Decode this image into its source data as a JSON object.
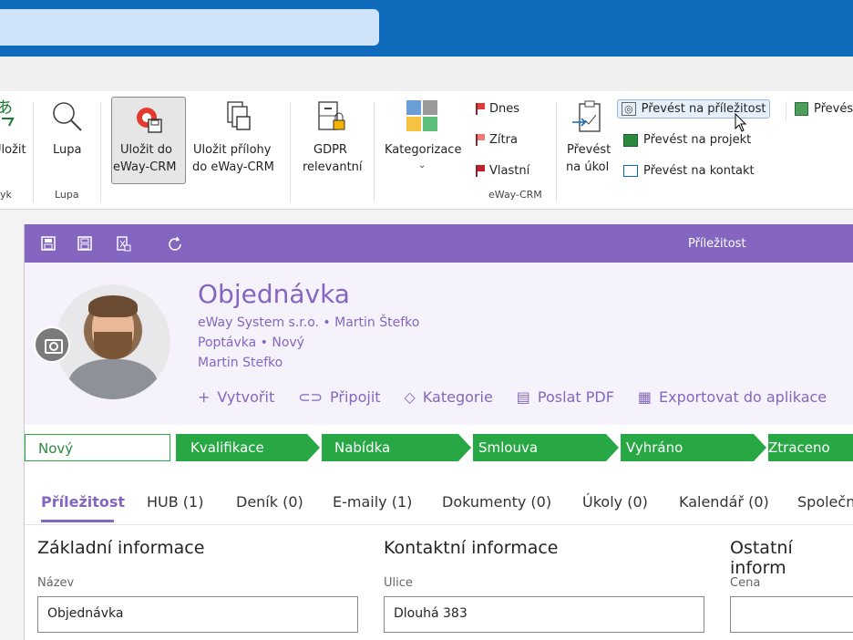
{
  "ribbon": {
    "btn_ulozit": "Uložit",
    "lbl_jazyk_partial": "yk",
    "btn_lupa": "Lupa",
    "group_lupa": "Lupa",
    "btn_ulozit_do_line1": "Uložit do",
    "btn_ulozit_do_line2": "eWay-CRM",
    "btn_ulozit_prilohy_line1": "Uložit přílohy",
    "btn_ulozit_prilohy_line2": "do eWay-CRM",
    "btn_gdpr_line1": "GDPR",
    "btn_gdpr_line2": "relevantní",
    "btn_kategorizace": "Kategorizace",
    "flag_dnes": "Dnes",
    "flag_zitra": "Zítra",
    "flag_vlastni": "Vlastní",
    "group_eway": "eWay-CRM",
    "btn_prevest_ukol_line1": "Převést",
    "btn_prevest_ukol_line2": "na úkol",
    "btn_prevest_prilezitost": "Převést na příležitost",
    "btn_prevest_projekt": "Převést na projekt",
    "btn_prevest_kontakt": "Převést na kontakt",
    "btn_prevest_partial": "Převés"
  },
  "window": {
    "title": "Příležitost",
    "record_title": "Objednávka",
    "line1": "eWay System s.r.o. • Martin Štefko",
    "line2": "Poptávka • Nový",
    "line3": "Martin Stefko",
    "actions": {
      "create": "Vytvořit",
      "attach": "Připojit",
      "category": "Kategorie",
      "pdf": "Poslat PDF",
      "export": "Exportovat do aplikace"
    },
    "stages": [
      "Nový",
      "Kvalifikace",
      "Nabídka",
      "Smlouva",
      "Vyhráno",
      "Ztraceno"
    ],
    "tabs": [
      "Příležitost",
      "HUB (1)",
      "Deník (0)",
      "E-maily (1)",
      "Dokumenty (0)",
      "Úkoly (0)",
      "Kalendář (0)",
      "Společn"
    ],
    "sections": {
      "basic": "Základní informace",
      "contact": "Kontaktní informace",
      "other": "Ostatní inform"
    },
    "fields": {
      "name_label": "Název",
      "name_value": "Objednávka",
      "street_label": "Ulice",
      "street_value": "Dlouhá 383",
      "price_label": "Cena",
      "price_value": ""
    }
  },
  "colors": {
    "accent": "#8466c0",
    "stage_green": "#28a745",
    "topbar": "#0f6cbd"
  }
}
